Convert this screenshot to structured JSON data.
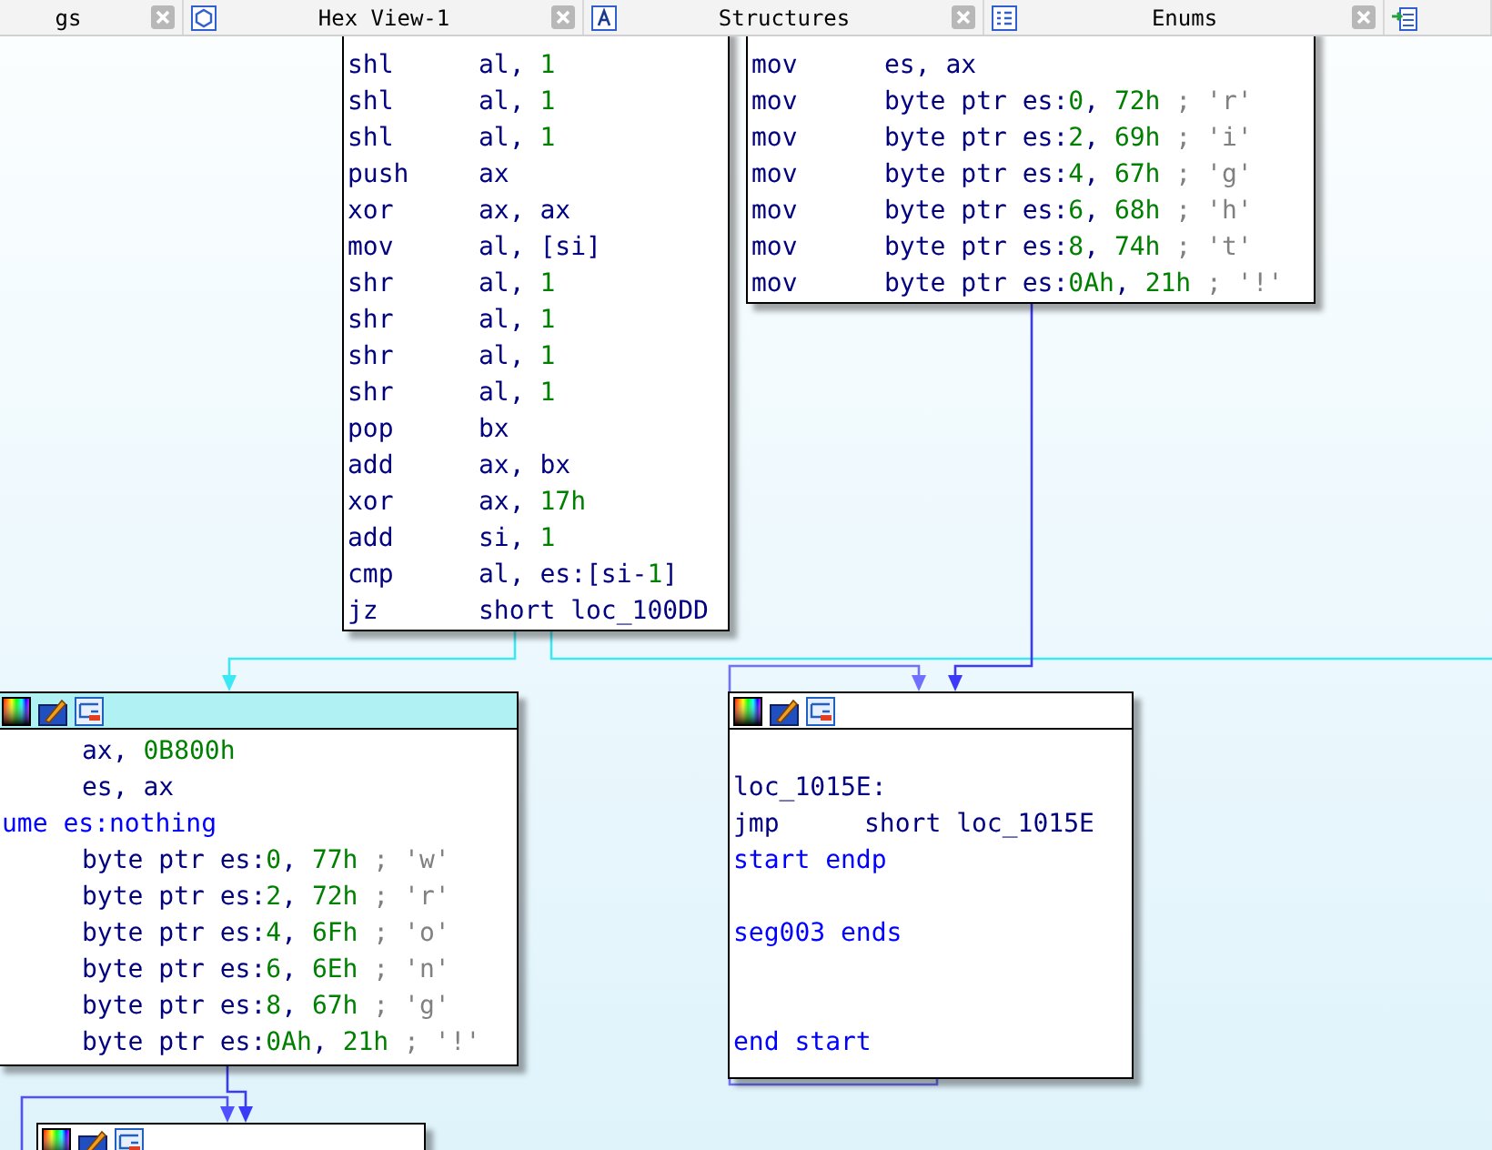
{
  "tabs": [
    {
      "kind": "text",
      "label": "gs"
    },
    {
      "kind": "text",
      "label": "Hex View-1"
    },
    {
      "kind": "text",
      "label": "Structures"
    },
    {
      "kind": "text",
      "label": "Enums"
    },
    {
      "kind": "icon"
    }
  ],
  "graph": {
    "nodes": [
      {
        "lines": [
          {
            "mnemonic": "shl",
            "operands": [
              {
                "text": "al, ",
                "kind": "reg"
              },
              {
                "text": "1",
                "kind": "num"
              }
            ]
          },
          {
            "mnemonic": "shl",
            "operands": [
              {
                "text": "al, ",
                "kind": "reg"
              },
              {
                "text": "1",
                "kind": "num"
              }
            ]
          },
          {
            "mnemonic": "shl",
            "operands": [
              {
                "text": "al, ",
                "kind": "reg"
              },
              {
                "text": "1",
                "kind": "num"
              }
            ]
          },
          {
            "mnemonic": "push",
            "operands": [
              {
                "text": "ax",
                "kind": "reg"
              }
            ]
          },
          {
            "mnemonic": "xor",
            "operands": [
              {
                "text": "ax, ax",
                "kind": "reg"
              }
            ]
          },
          {
            "mnemonic": "mov",
            "operands": [
              {
                "text": "al, [si]",
                "kind": "reg"
              }
            ]
          },
          {
            "mnemonic": "shr",
            "operands": [
              {
                "text": "al, ",
                "kind": "reg"
              },
              {
                "text": "1",
                "kind": "num"
              }
            ]
          },
          {
            "mnemonic": "shr",
            "operands": [
              {
                "text": "al, ",
                "kind": "reg"
              },
              {
                "text": "1",
                "kind": "num"
              }
            ]
          },
          {
            "mnemonic": "shr",
            "operands": [
              {
                "text": "al, ",
                "kind": "reg"
              },
              {
                "text": "1",
                "kind": "num"
              }
            ]
          },
          {
            "mnemonic": "shr",
            "operands": [
              {
                "text": "al, ",
                "kind": "reg"
              },
              {
                "text": "1",
                "kind": "num"
              }
            ]
          },
          {
            "mnemonic": "pop",
            "operands": [
              {
                "text": "bx",
                "kind": "reg"
              }
            ]
          },
          {
            "mnemonic": "add",
            "operands": [
              {
                "text": "ax, bx",
                "kind": "reg"
              }
            ]
          },
          {
            "mnemonic": "xor",
            "operands": [
              {
                "text": "ax, ",
                "kind": "reg"
              },
              {
                "text": "17h",
                "kind": "num"
              }
            ]
          },
          {
            "mnemonic": "add",
            "operands": [
              {
                "text": "si, ",
                "kind": "reg"
              },
              {
                "text": "1",
                "kind": "num"
              }
            ]
          },
          {
            "mnemonic": "cmp",
            "operands": [
              {
                "text": "al, es:[si-",
                "kind": "reg"
              },
              {
                "text": "1",
                "kind": "num"
              },
              {
                "text": "]",
                "kind": "reg"
              }
            ]
          },
          {
            "mnemonic": "jz",
            "operands": [
              {
                "text": "short loc_100DD",
                "kind": "reg"
              }
            ]
          }
        ]
      },
      {
        "lines": [
          {
            "mnemonic": "mov",
            "operands": [
              {
                "text": "es, ax",
                "kind": "reg"
              }
            ]
          },
          {
            "mnemonic": "mov",
            "operands": [
              {
                "text": "byte ptr es:",
                "kind": "reg"
              },
              {
                "text": "0",
                "kind": "num"
              },
              {
                "text": ", ",
                "kind": "reg"
              },
              {
                "text": "72h",
                "kind": "num"
              },
              {
                "text": " ; ",
                "kind": "cmt"
              },
              {
                "text": "'r'",
                "kind": "cmt"
              }
            ]
          },
          {
            "mnemonic": "mov",
            "operands": [
              {
                "text": "byte ptr es:",
                "kind": "reg"
              },
              {
                "text": "2",
                "kind": "num"
              },
              {
                "text": ", ",
                "kind": "reg"
              },
              {
                "text": "69h",
                "kind": "num"
              },
              {
                "text": " ; ",
                "kind": "cmt"
              },
              {
                "text": "'i'",
                "kind": "cmt"
              }
            ]
          },
          {
            "mnemonic": "mov",
            "operands": [
              {
                "text": "byte ptr es:",
                "kind": "reg"
              },
              {
                "text": "4",
                "kind": "num"
              },
              {
                "text": ", ",
                "kind": "reg"
              },
              {
                "text": "67h",
                "kind": "num"
              },
              {
                "text": " ; ",
                "kind": "cmt"
              },
              {
                "text": "'g'",
                "kind": "cmt"
              }
            ]
          },
          {
            "mnemonic": "mov",
            "operands": [
              {
                "text": "byte ptr es:",
                "kind": "reg"
              },
              {
                "text": "6",
                "kind": "num"
              },
              {
                "text": ", ",
                "kind": "reg"
              },
              {
                "text": "68h",
                "kind": "num"
              },
              {
                "text": " ; ",
                "kind": "cmt"
              },
              {
                "text": "'h'",
                "kind": "cmt"
              }
            ]
          },
          {
            "mnemonic": "mov",
            "operands": [
              {
                "text": "byte ptr es:",
                "kind": "reg"
              },
              {
                "text": "8",
                "kind": "num"
              },
              {
                "text": ", ",
                "kind": "reg"
              },
              {
                "text": "74h",
                "kind": "num"
              },
              {
                "text": " ; ",
                "kind": "cmt"
              },
              {
                "text": "'t'",
                "kind": "cmt"
              }
            ]
          },
          {
            "mnemonic": "mov",
            "operands": [
              {
                "text": "byte ptr es:",
                "kind": "reg"
              },
              {
                "text": "0Ah",
                "kind": "num"
              },
              {
                "text": ", ",
                "kind": "reg"
              },
              {
                "text": "21h",
                "kind": "num"
              },
              {
                "text": " ; ",
                "kind": "cmt"
              },
              {
                "text": "'!'",
                "kind": "cmt"
              }
            ]
          }
        ]
      },
      {
        "selected": true,
        "lines": [
          {
            "operands": [
              {
                "text": "ax, ",
                "kind": "reg"
              },
              {
                "text": "0B800h",
                "kind": "num"
              }
            ]
          },
          {
            "operands": [
              {
                "text": "es, ax",
                "kind": "reg"
              }
            ]
          },
          {
            "directive": "ume es:nothing"
          },
          {
            "operands": [
              {
                "text": "byte ptr es:",
                "kind": "reg"
              },
              {
                "text": "0",
                "kind": "num"
              },
              {
                "text": ", ",
                "kind": "reg"
              },
              {
                "text": "77h",
                "kind": "num"
              },
              {
                "text": " ; ",
                "kind": "cmt"
              },
              {
                "text": "'w'",
                "kind": "cmt"
              }
            ]
          },
          {
            "operands": [
              {
                "text": "byte ptr es:",
                "kind": "reg"
              },
              {
                "text": "2",
                "kind": "num"
              },
              {
                "text": ", ",
                "kind": "reg"
              },
              {
                "text": "72h",
                "kind": "num"
              },
              {
                "text": " ; ",
                "kind": "cmt"
              },
              {
                "text": "'r'",
                "kind": "cmt"
              }
            ]
          },
          {
            "operands": [
              {
                "text": "byte ptr es:",
                "kind": "reg"
              },
              {
                "text": "4",
                "kind": "num"
              },
              {
                "text": ", ",
                "kind": "reg"
              },
              {
                "text": "6Fh",
                "kind": "num"
              },
              {
                "text": " ; ",
                "kind": "cmt"
              },
              {
                "text": "'o'",
                "kind": "cmt"
              }
            ]
          },
          {
            "operands": [
              {
                "text": "byte ptr es:",
                "kind": "reg"
              },
              {
                "text": "6",
                "kind": "num"
              },
              {
                "text": ", ",
                "kind": "reg"
              },
              {
                "text": "6Eh",
                "kind": "num"
              },
              {
                "text": " ; ",
                "kind": "cmt"
              },
              {
                "text": "'n'",
                "kind": "cmt"
              }
            ]
          },
          {
            "operands": [
              {
                "text": "byte ptr es:",
                "kind": "reg"
              },
              {
                "text": "8",
                "kind": "num"
              },
              {
                "text": ", ",
                "kind": "reg"
              },
              {
                "text": "67h",
                "kind": "num"
              },
              {
                "text": " ; ",
                "kind": "cmt"
              },
              {
                "text": "'g'",
                "kind": "cmt"
              }
            ]
          },
          {
            "operands": [
              {
                "text": "byte ptr es:",
                "kind": "reg"
              },
              {
                "text": "0Ah",
                "kind": "num"
              },
              {
                "text": ", ",
                "kind": "reg"
              },
              {
                "text": "21h",
                "kind": "num"
              },
              {
                "text": " ; ",
                "kind": "cmt"
              },
              {
                "text": "'!'",
                "kind": "cmt"
              }
            ]
          }
        ]
      },
      {
        "selected": false,
        "lines": [
          {
            "label": "loc_1015E:"
          },
          {
            "mnemonic": "jmp",
            "operands": [
              {
                "text": "short loc_1015E",
                "kind": "reg"
              }
            ]
          },
          {
            "directive": "start endp"
          },
          {
            "directive": "seg003 ends"
          },
          {
            "directive": "end start"
          }
        ]
      },
      {
        "selected": false
      }
    ]
  }
}
